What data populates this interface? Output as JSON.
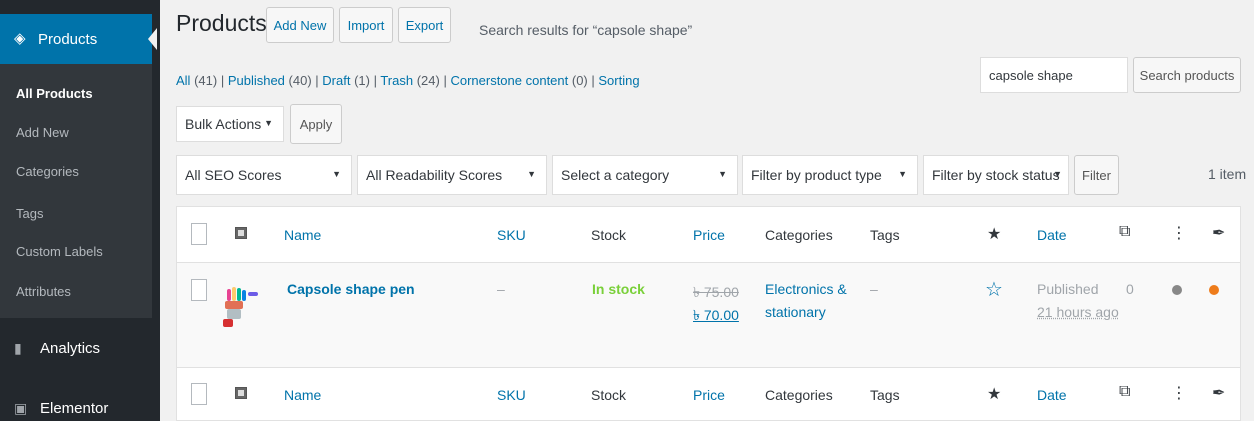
{
  "sidebar": {
    "top_item": {
      "label": "Products",
      "icon": "products-bag-icon"
    },
    "submenu": [
      {
        "label": "All Products",
        "current": true
      },
      {
        "label": "Add New"
      },
      {
        "label": "Categories"
      },
      {
        "label": "Tags"
      },
      {
        "label": "Custom Labels"
      },
      {
        "label": "Attributes"
      }
    ],
    "main_items": [
      {
        "label": "Analytics",
        "icon": "bar-chart-icon"
      },
      {
        "label": "Elementor",
        "icon": "elementor-icon"
      }
    ]
  },
  "header": {
    "title": "Products",
    "add_new": "Add New",
    "import": "Import",
    "export": "Export",
    "subtitle": "Search results for “capsole shape”"
  },
  "views": [
    {
      "label": "All",
      "count": "(41)"
    },
    {
      "label": "Published",
      "count": "(40)"
    },
    {
      "label": "Draft",
      "count": "(1)"
    },
    {
      "label": "Trash",
      "count": "(24)"
    },
    {
      "label": "Cornerstone content",
      "count": "(0)"
    },
    {
      "label": "Sorting",
      "count": ""
    }
  ],
  "search": {
    "value": "capsole shape",
    "button": "Search products"
  },
  "bulk": {
    "selected": "Bulk Actions",
    "apply": "Apply"
  },
  "filters": {
    "seo": "All SEO Scores",
    "readability": "All Readability Scores",
    "category": "Select a category",
    "product_type": "Filter by product type",
    "stock_status": "Filter by stock status",
    "filter_button": "Filter",
    "items_count": "1 item"
  },
  "columns": {
    "name": "Name",
    "sku": "SKU",
    "stock": "Stock",
    "price": "Price",
    "categories": "Categories",
    "tags": "Tags",
    "date": "Date"
  },
  "product": {
    "name": "Capsole shape pen",
    "sku": "–",
    "stock": "In stock",
    "regular_price": "৳ 75.00",
    "sale_price": "৳ 70.00",
    "category_line1": "Electronics &",
    "category_line2": "stationary",
    "tags": "–",
    "status": "Published",
    "date": "21 hours ago",
    "links_count": "0"
  },
  "colors": {
    "accent": "#0073aa",
    "sidebar_bg": "#23282d",
    "in_stock": "#7ad03a",
    "seo_dot": "#ee7c1b",
    "readability_dot": "#888888"
  }
}
